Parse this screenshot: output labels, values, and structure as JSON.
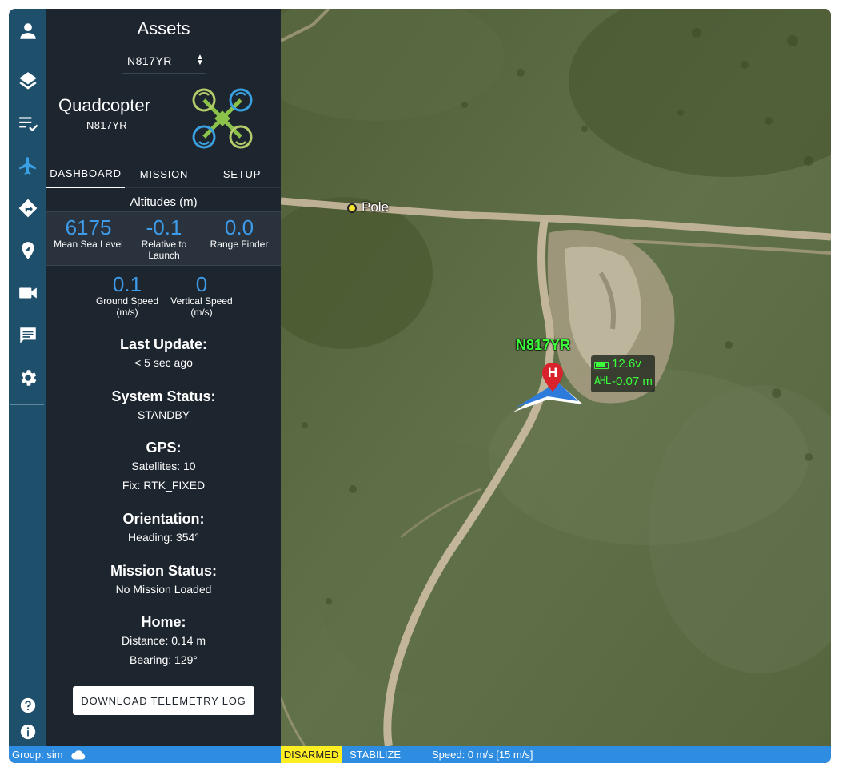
{
  "panel": {
    "title": "Assets",
    "selected_asset": "N817YR",
    "vehicle_type": "Quadcopter",
    "vehicle_id": "N817YR"
  },
  "tabs": [
    {
      "label": "DASHBOARD",
      "active": true
    },
    {
      "label": "MISSION",
      "active": false
    },
    {
      "label": "SETUP",
      "active": false
    }
  ],
  "altitudes": {
    "title": "Altitudes (m)",
    "msl": {
      "value": "6175",
      "label": "Mean Sea Level"
    },
    "rel": {
      "value": "-0.1",
      "label1": "Relative to",
      "label2": "Launch"
    },
    "range": {
      "value": "0.0",
      "label": "Range Finder"
    }
  },
  "speeds": {
    "ground": {
      "value": "0.1",
      "label1": "Ground Speed",
      "label2": "(m/s)"
    },
    "vertical": {
      "value": "0",
      "label1": "Vertical Speed",
      "label2": "(m/s)"
    }
  },
  "last_update": {
    "heading": "Last Update:",
    "value": "< 5 sec ago"
  },
  "system_status": {
    "heading": "System Status:",
    "value": "STANDBY"
  },
  "gps": {
    "heading": "GPS:",
    "satellites": "Satellites: 10",
    "fix": "Fix: RTK_FIXED"
  },
  "orientation": {
    "heading": "Orientation:",
    "value": "Heading: 354°"
  },
  "mission_status": {
    "heading": "Mission Status:",
    "value": "No Mission Loaded"
  },
  "home": {
    "heading": "Home:",
    "distance": "Distance: 0.14 m",
    "bearing": "Bearing: 129°"
  },
  "download_button": "DOWNLOAD TELEMETRY LOG",
  "map": {
    "poi_label": "Pole",
    "vehicle_label": "N817YR",
    "home_marker": "H",
    "battery": "12.6v",
    "ahl_label": "AHL",
    "ahl_value": "-0.07 m"
  },
  "status_bar": {
    "group": "Group: sim",
    "armed_state": "DISARMED",
    "mode": "STABILIZE",
    "speed": "Speed: 0 m/s [15 m/s]"
  },
  "colors": {
    "rail": "#1e4f6b",
    "panel": "#1d252e",
    "accent": "#3d9be9",
    "status_bar": "#2e8ce1",
    "disarmed": "#ffee22",
    "vehicle_label": "#3cff3c"
  },
  "rail_icons": [
    "user-icon",
    "layers-icon",
    "checklist-icon",
    "airplane-icon",
    "directions-icon",
    "map-pin-icon",
    "video-icon",
    "chat-icon",
    "gear-icon",
    "help-icon",
    "info-icon"
  ]
}
